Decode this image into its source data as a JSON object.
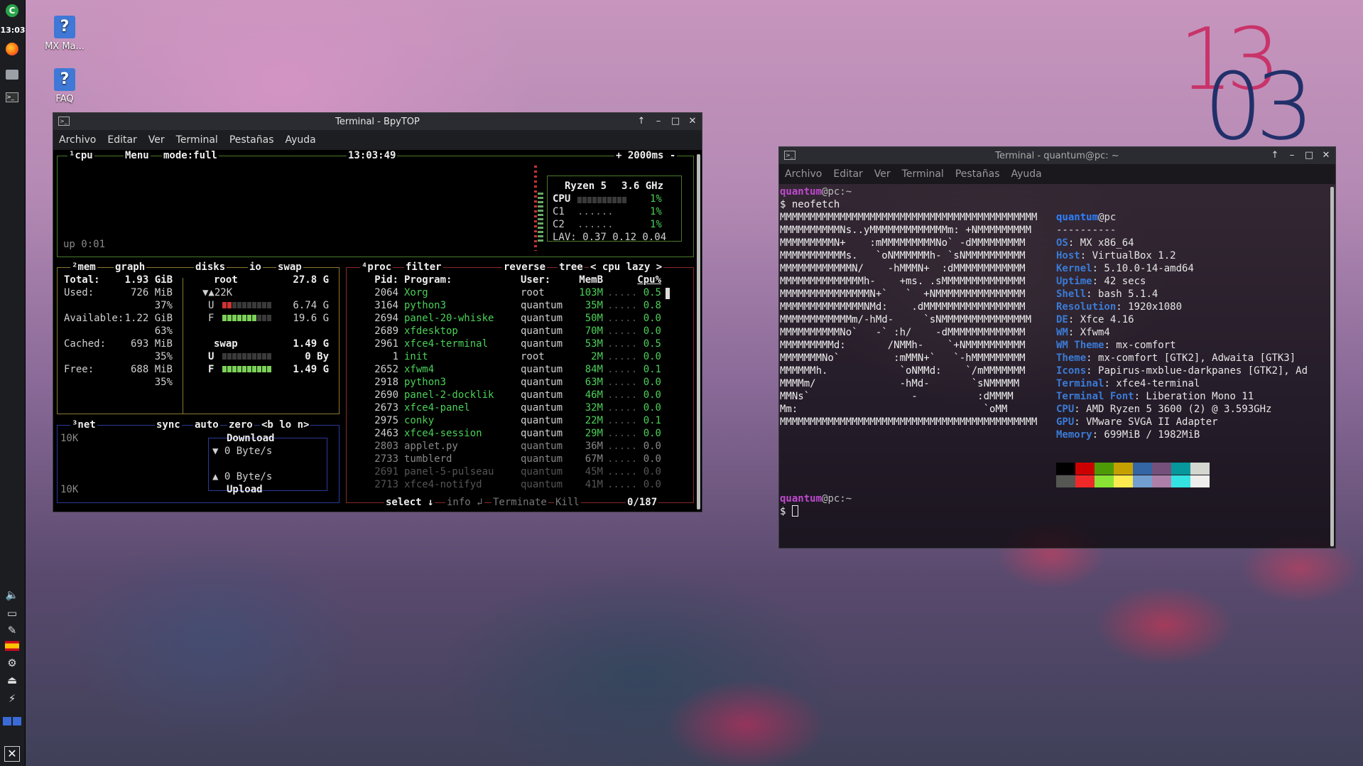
{
  "panel": {
    "time": "13:03"
  },
  "desktop_icons": [
    {
      "label": "MX Ma..."
    },
    {
      "label": "FAQ"
    }
  ],
  "big_clock": {
    "hour": "13",
    "minute": "03"
  },
  "bpytop": {
    "window_title": "Terminal - BpyTOP",
    "menu": [
      "Archivo",
      "Editar",
      "Ver",
      "Terminal",
      "Pestañas",
      "Ayuda"
    ],
    "cpu_box": {
      "label": "¹cpu",
      "menu": "Menu",
      "mode": "mode:full",
      "clock": "13:03:49",
      "interval": "+ 2000ms -",
      "uptime": "up 0:01",
      "model": "Ryzen 5",
      "freq": "3.6 GHz",
      "rows": [
        {
          "name": "CPU",
          "pct": "1%",
          "fill": 0.01
        },
        {
          "name": "C1",
          "pct": "1%",
          "fill": 0.01
        },
        {
          "name": "C2",
          "pct": "1%",
          "fill": 0.01
        }
      ],
      "lav": "LAV: 0.37 0.12 0.04"
    },
    "mem_box": {
      "tabs": [
        "²mem",
        "graph",
        "disks",
        "io",
        "swap"
      ],
      "rows": [
        {
          "label": "Total:",
          "value": "1.93 GiB",
          "pct": ""
        },
        {
          "label": "Used:",
          "value": "726 MiB",
          "pct": "37%"
        },
        {
          "label": "Available:",
          "value": "1.22 GiB",
          "pct": "63%"
        },
        {
          "label": "Cached:",
          "value": "693 MiB",
          "pct": "35%"
        },
        {
          "label": "Free:",
          "value": "688 MiB",
          "pct": "35%"
        }
      ],
      "disk_root": {
        "name": "root",
        "size": "27.8 G",
        "io": "▼▲22K",
        "used_label": "U",
        "used": "6.74 G",
        "used_fill": 0.24,
        "free_label": "F",
        "free": "19.6 G",
        "free_fill": 0.7
      },
      "swap": {
        "name": "swap",
        "size": "1.49 G",
        "used_label": "U",
        "used": "0 By",
        "used_fill": 0,
        "free_label": "F",
        "free": "1.49 G",
        "free_fill": 1
      }
    },
    "net_box": {
      "label": "³net",
      "sync": "sync",
      "auto": "auto",
      "zero": "zero",
      "iface": "<b lo n>",
      "top_scale": "10K",
      "bottom_scale": "10K",
      "download_label": "Download",
      "download": "▼ 0 Byte/s",
      "upload": "▲ 0 Byte/s",
      "upload_label": "Upload"
    },
    "proc_box": {
      "label": "⁴proc",
      "filter": "filter",
      "reverse": "reverse",
      "tree": "tree",
      "sort": "< cpu lazy >",
      "headers": {
        "pid": "Pid:",
        "program": "Program:",
        "user": "User:",
        "mem": "MemB",
        "cpu": "Cpu%"
      },
      "rows": [
        {
          "pid": "2064",
          "program": "Xorg",
          "user": "root",
          "mem": "103M",
          "cpu": "0.5"
        },
        {
          "pid": "3164",
          "program": "python3",
          "user": "quantum",
          "mem": "35M",
          "cpu": "0.8"
        },
        {
          "pid": "2694",
          "program": "panel-20-whiske",
          "user": "quantum",
          "mem": "50M",
          "cpu": "0.0"
        },
        {
          "pid": "2689",
          "program": "xfdesktop",
          "user": "quantum",
          "mem": "70M",
          "cpu": "0.0"
        },
        {
          "pid": "2961",
          "program": "xfce4-terminal",
          "user": "quantum",
          "mem": "53M",
          "cpu": "0.5"
        },
        {
          "pid": "1",
          "program": "init",
          "user": "root",
          "mem": "2M",
          "cpu": "0.0"
        },
        {
          "pid": "2652",
          "program": "xfwm4",
          "user": "quantum",
          "mem": "84M",
          "cpu": "0.1"
        },
        {
          "pid": "2918",
          "program": "python3",
          "user": "quantum",
          "mem": "63M",
          "cpu": "0.0"
        },
        {
          "pid": "2690",
          "program": "panel-2-docklik",
          "user": "quantum",
          "mem": "46M",
          "cpu": "0.0"
        },
        {
          "pid": "2673",
          "program": "xfce4-panel",
          "user": "quantum",
          "mem": "32M",
          "cpu": "0.0"
        },
        {
          "pid": "2975",
          "program": "conky",
          "user": "quantum",
          "mem": "22M",
          "cpu": "0.1"
        },
        {
          "pid": "2463",
          "program": "xfce4-session",
          "user": "quantum",
          "mem": "29M",
          "cpu": "0.0"
        },
        {
          "pid": "2803",
          "program": "applet.py",
          "user": "quantum",
          "mem": "36M",
          "cpu": "0.0"
        },
        {
          "pid": "2733",
          "program": "tumblerd",
          "user": "quantum",
          "mem": "67M",
          "cpu": "0.0"
        },
        {
          "pid": "2691",
          "program": "panel-5-pulseau",
          "user": "quantum",
          "mem": "45M",
          "cpu": "0.0"
        },
        {
          "pid": "2713",
          "program": "xfce4-notifyd",
          "user": "quantum",
          "mem": "41M",
          "cpu": "0.0"
        }
      ],
      "footer": {
        "select": "select ↓",
        "info": "info ↲",
        "terminate": "Terminate",
        "kill": "Kill",
        "count": "0/187"
      }
    }
  },
  "neofetch": {
    "window_title": "Terminal - quantum@pc: ~",
    "menu": [
      "Archivo",
      "Editar",
      "Ver",
      "Terminal",
      "Pestañas",
      "Ayuda"
    ],
    "prompt_user": "quantum",
    "prompt_host": "@pc:~",
    "command": "$ neofetch",
    "ascii": [
      "MMMMMMMMMMMMMMMMMMMMMMMMMMMMMMMMMMMMMMMMMMM",
      "MMMMMMMMMMNs..yMMMMMMMMMMMMMm: +NMMMMMMMMM",
      "MMMMMMMMMN+    :mMMMMMMMMMNo` -dMMMMMMMMM",
      "MMMMMMMMMMMs.   `oNMMMMMMh- `sNMMMMMMMMMM",
      "MMMMMMMMMMMMN/    -hMMMN+  :dMMMMMMMMMMMM",
      "MMMMMMMMMMMMMMh-    +ms. .sMMMMMMMMMMMMMM",
      "MMMMMMMMMMMMMMMN+`   `  +NMMMMMMMMMMMMMMM",
      "MMMMMMMMMMMMMMNMd:    .dMMMMMMMMMMMMMMMMM",
      "MMMMMMMMMMMMm/-hMd-     `sNMMMMMMMMMMMMMMM",
      "MMMMMMMMMMNo`   -` :h/    -dMMMMMMMMMMMMM",
      "MMMMMMMMMd:       /NMMh-    `+NMMMMMMMMMM",
      "MMMMMMMNo`         :mMMN+`   `-hMMMMMMMMM",
      "MMMMMMh.            `oNMMd:    `/mMMMMMMM",
      "MMMMm/              -hMd-       `sNMMMMM",
      "MMNs`                 -          :dMMMM",
      "Mm:                               `oMM",
      "MMMMMMMMMMMMMMMMMMMMMMMMMMMMMMMMMMMMMMMMMMM"
    ],
    "user": "quantum",
    "host": "@pc",
    "separator": "----------",
    "info": [
      {
        "key": "OS",
        "value": ": MX x86_64"
      },
      {
        "key": "Host",
        "value": ": VirtualBox 1.2"
      },
      {
        "key": "Kernel",
        "value": ": 5.10.0-14-amd64"
      },
      {
        "key": "Uptime",
        "value": ": 42 secs"
      },
      {
        "key": "Shell",
        "value": ": bash 5.1.4"
      },
      {
        "key": "Resolution",
        "value": ": 1920x1080"
      },
      {
        "key": "DE",
        "value": ": Xfce 4.16"
      },
      {
        "key": "WM",
        "value": ": Xfwm4"
      },
      {
        "key": "WM Theme",
        "value": ": mx-comfort"
      },
      {
        "key": "Theme",
        "value": ": mx-comfort [GTK2], Adwaita [GTK3]"
      },
      {
        "key": "Icons",
        "value": ": Papirus-mxblue-darkpanes [GTK2], Ad"
      },
      {
        "key": "Terminal",
        "value": ": xfce4-terminal"
      },
      {
        "key": "Terminal Font",
        "value": ": Liberation Mono 11"
      },
      {
        "key": "CPU",
        "value": ": AMD Ryzen 5 3600 (2) @ 3.593GHz"
      },
      {
        "key": "GPU",
        "value": ": VMware SVGA II Adapter"
      },
      {
        "key": "Memory",
        "value": ": 699MiB / 1982MiB"
      }
    ],
    "palette_top": [
      "#000000",
      "#cc0000",
      "#4e9a06",
      "#c4a000",
      "#3465a4",
      "#75507b",
      "#06989a",
      "#d3d7cf"
    ],
    "palette_bottom": [
      "#555753",
      "#ef2929",
      "#8ae234",
      "#fce94f",
      "#729fcf",
      "#ad7fa8",
      "#34e2e2",
      "#eeeeec"
    ],
    "prompt2_user": "quantum",
    "prompt2_host": "@pc:~",
    "prompt2": "$"
  }
}
